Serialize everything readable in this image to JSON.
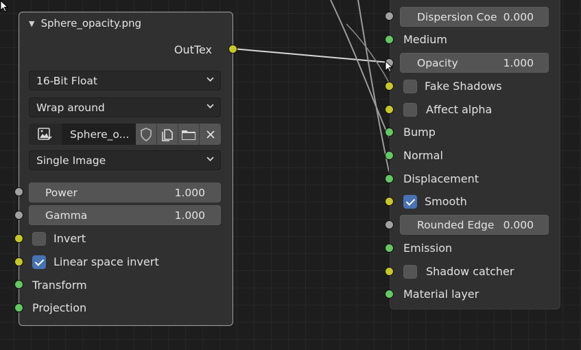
{
  "image_node": {
    "title": "Sphere_opacity.png",
    "collapse_arrow": "▼",
    "output_label": "OutTex",
    "bit_depth": "16-Bit Float",
    "wrap_mode": "Wrap around",
    "image_name": "Sphere_o...",
    "image_type": "Single Image",
    "power": {
      "label": "Power",
      "value": "1.000"
    },
    "gamma": {
      "label": "Gamma",
      "value": "1.000"
    },
    "invert": {
      "label": "Invert",
      "checked": false
    },
    "linear_space_invert": {
      "label": "Linear space invert",
      "checked": true
    },
    "transform_label": "Transform",
    "projection_label": "Projection"
  },
  "material_node": {
    "dispersion": {
      "label": "Dispersion Coe",
      "value": "0.000"
    },
    "medium_label": "Medium",
    "opacity": {
      "label": "Opacity",
      "value": "1.000"
    },
    "fake_shadows": {
      "label": "Fake Shadows",
      "checked": false
    },
    "affect_alpha": {
      "label": "Affect alpha",
      "checked": false
    },
    "bump_label": "Bump",
    "normal_label": "Normal",
    "displacement_label": "Displacement",
    "smooth": {
      "label": "Smooth",
      "checked": true
    },
    "rounded_edge": {
      "label": "Rounded Edge",
      "value": "0.000"
    },
    "emission_label": "Emission",
    "shadow_catcher": {
      "label": "Shadow catcher",
      "checked": false
    },
    "material_layer_label": "Material layer"
  },
  "colors": {
    "socket_gray": "#a1a1a1",
    "socket_green": "#63c763",
    "socket_yellow": "#c7c729",
    "checkbox_on": "#4772b3",
    "node_bg": "#303030"
  },
  "icons": [
    "collapse-arrow-icon",
    "chevron-down-icon",
    "image-icon",
    "shield-icon",
    "duplicate-icon",
    "folder-icon",
    "close-icon",
    "mouse-pointer-icon"
  ]
}
